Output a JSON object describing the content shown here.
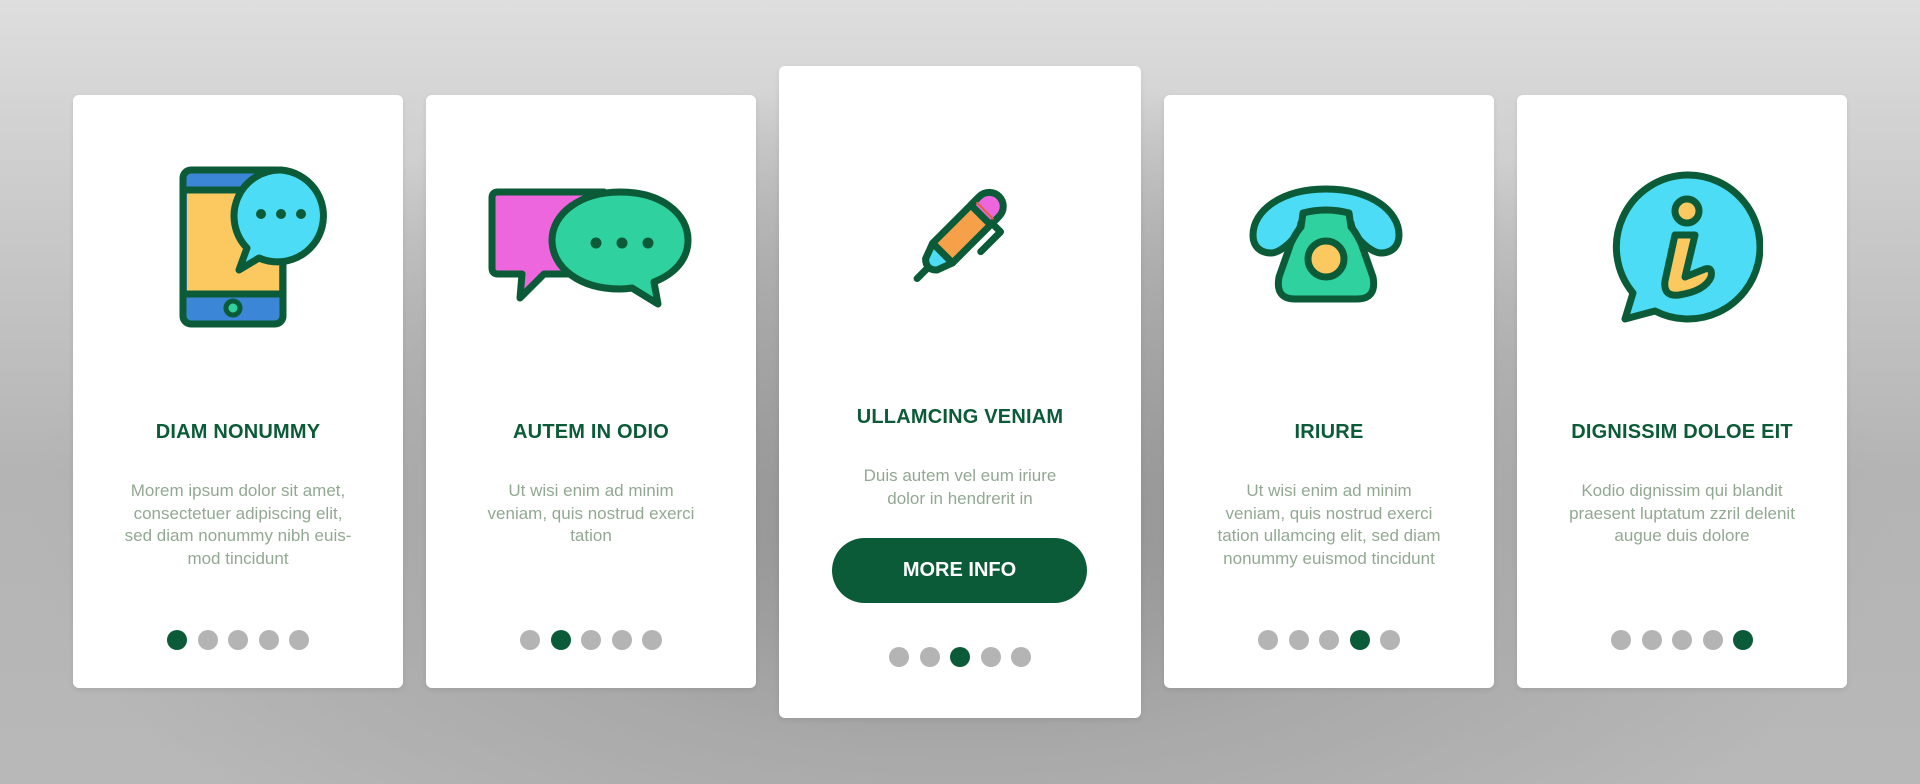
{
  "colors": {
    "brand_green": "#0b5b38",
    "body_text": "#93a893",
    "dot_inactive": "#b4b4b4",
    "icon_outline": "#0b5b38",
    "icon_blue": "#3b86d6",
    "icon_yellow": "#fcc860",
    "icon_cyan": "#4ddcf5",
    "icon_teal": "#2fd19f",
    "icon_pink": "#ee66dd",
    "icon_orange": "#f6a04a"
  },
  "cards": [
    {
      "icon": "smartphone-chat-icon",
      "title": "DIAM NONUMMY",
      "body": "Morem ipsum dolor sit amet,\nconsectetuer adipiscing elit,\nsed diam nonummy nibh euis-\nmod tincidunt",
      "page_index": 1,
      "page_count": 5
    },
    {
      "icon": "chat-bubbles-icon",
      "title": "AUTEM IN ODIO",
      "body": "Ut wisi enim ad minim\nveniam, quis nostrud exerci\ntation",
      "page_index": 2,
      "page_count": 5
    },
    {
      "icon": "pen-icon",
      "title": "ULLAMCING VENIAM",
      "body": "Duis autem vel eum iriure\ndolor in hendrerit in",
      "button_label": "MORE INFO",
      "page_index": 3,
      "page_count": 5
    },
    {
      "icon": "telephone-icon",
      "title": "IRIURE",
      "body": "Ut wisi enim ad minim\nveniam, quis nostrud exerci\ntation ullamcing elit, sed diam\nnonummy euismod tincidunt",
      "page_index": 4,
      "page_count": 5
    },
    {
      "icon": "info-bubble-icon",
      "title": "DIGNISSIM DOLOE EIT",
      "body": "Kodio dignissim qui blandit\npraesent luptatum zzril delenit\naugue duis dolore",
      "page_index": 5,
      "page_count": 5
    }
  ]
}
